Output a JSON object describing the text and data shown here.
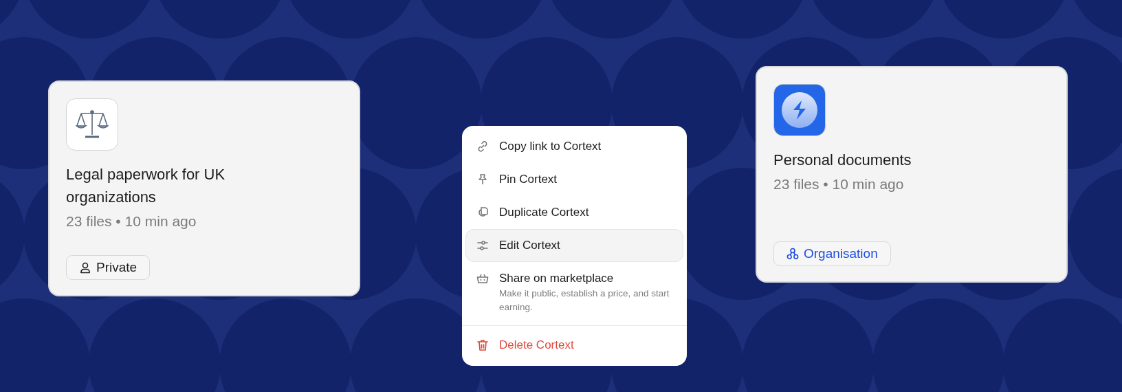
{
  "cards": [
    {
      "kind": "legal",
      "title": "Legal paperwork for UK organizations",
      "meta": "23 files • 10 min ago",
      "badge": {
        "kind": "private",
        "label": "Private"
      }
    },
    {
      "kind": "bolt",
      "title": "Personal documents",
      "meta": "23 files • 10 min ago",
      "badge": {
        "kind": "organisation",
        "label": "Organisation"
      }
    }
  ],
  "menu": {
    "items": [
      {
        "kind": "action",
        "label": "Copy link to Cortext",
        "selected": false
      },
      {
        "kind": "action",
        "label": "Pin Cortext",
        "selected": false
      },
      {
        "kind": "action",
        "label": "Duplicate Cortext",
        "selected": false
      },
      {
        "kind": "action",
        "label": "Edit Cortext",
        "selected": true
      },
      {
        "kind": "action",
        "label": "Share on marketplace",
        "description": "Make it public, establish a price, and start earning.",
        "selected": false
      },
      {
        "kind": "danger",
        "label": "Delete Cortext",
        "selected": false
      }
    ]
  }
}
